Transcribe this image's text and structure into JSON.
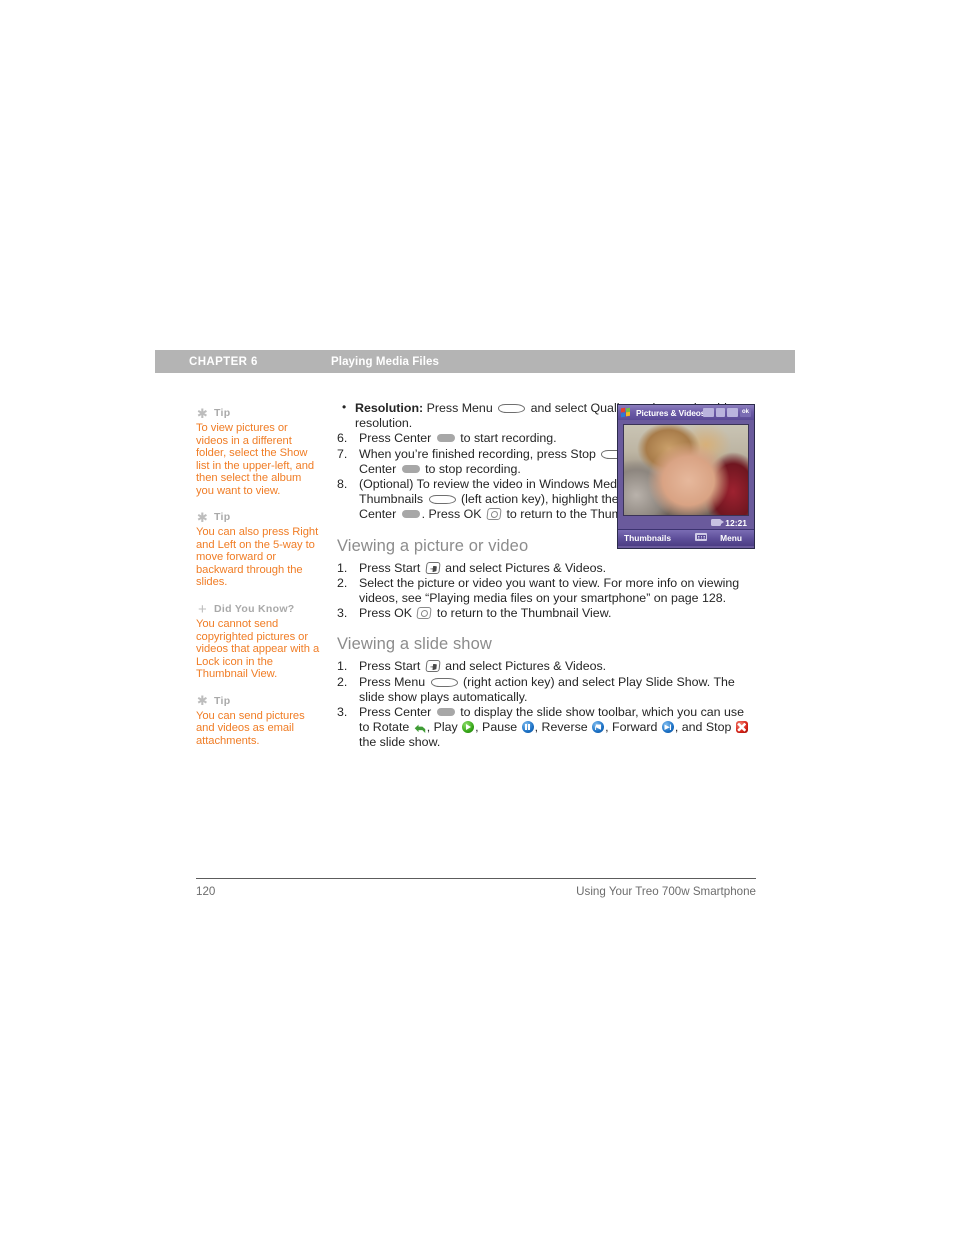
{
  "header": {
    "chapter_label": "CHAPTER 6",
    "chapter_title": "Playing Media Files"
  },
  "sidebar": {
    "tips": [
      {
        "icon": "asterisk-icon",
        "heading": "Tip",
        "body": "To view pictures or videos in a different folder, select the Show list in the upper-left, and then select the album you want to view."
      },
      {
        "icon": "asterisk-icon",
        "heading": "Tip",
        "body": "You can also press Right and Left on the 5-way to move forward or backward through the slides."
      },
      {
        "icon": "plus-icon",
        "heading": "Did You Know?",
        "body": "You cannot send copyrighted pictures or videos that appear with a Lock icon in the Thumbnail View."
      },
      {
        "icon": "asterisk-icon",
        "heading": "Tip",
        "body": "You can send pictures and videos as email attachments."
      }
    ],
    "accent_color": "#f07d26",
    "heading_color": "#a9a9a9"
  },
  "main": {
    "bullet": {
      "term": "Resolution:",
      "text_before_key": " Press Menu ",
      "text_after_key": " and select Quality to change the video resolution."
    },
    "steps_continued": [
      {
        "num": "6.",
        "parts": [
          "Press Center ",
          " to start recording."
        ]
      },
      {
        "num": "7.",
        "parts": [
          "When you’re finished recording, press Stop ",
          " (left action key) or Center ",
          " to stop recording."
        ]
      },
      {
        "num": "8.",
        "parts": [
          "(Optional) To review the video in Windows Media Player Mobile, press Thumbnails ",
          " (left action key), highlight the video, and then press Center ",
          ". Press OK ",
          " to return to the Thumbnail View."
        ]
      }
    ],
    "section_view_picture": {
      "heading": "Viewing a picture or video",
      "steps": [
        {
          "num": "1.",
          "parts": [
            "Press Start ",
            " and select Pictures & Videos."
          ]
        },
        {
          "num": "2.",
          "parts": [
            "Select the picture or video you want to view. For more info on viewing videos, see “Playing media files on your smartphone” on page 128."
          ]
        },
        {
          "num": "3.",
          "parts": [
            "Press OK ",
            " to return to the Thumbnail View."
          ]
        }
      ]
    },
    "section_slide_show": {
      "heading": "Viewing a slide show",
      "steps": [
        {
          "num": "1.",
          "parts": [
            "Press Start ",
            " and select Pictures & Videos."
          ]
        },
        {
          "num": "2.",
          "parts": [
            "Press Menu ",
            " (right action key) and select Play Slide Show. The slide show plays automatically."
          ]
        },
        {
          "num": "3.",
          "parts": [
            "Press Center ",
            " to display the slide show toolbar, which you can use to Rotate ",
            ", Play ",
            ", Pause ",
            ", Reverse ",
            ", Forward ",
            ", and Stop ",
            " the slide show."
          ]
        }
      ],
      "toolbar_icon_labels": [
        "Rotate",
        "Play",
        "Pause",
        "Reverse",
        "Forward",
        "Stop"
      ]
    }
  },
  "phone_screenshot": {
    "title": "Pictures & Videos",
    "status_icons": [
      "volume-icon",
      "signal-icon",
      "battery-icon",
      "ok-icon"
    ],
    "ok_label": "ok",
    "time": "12:21",
    "media_icon": "video-camera-icon",
    "softkey_left": "Thumbnails",
    "softkey_center_icon": "keyboard-icon",
    "softkey_right": "Menu",
    "title_bar_color": "#6d5ca8",
    "soft_bar_color": "#5d4e99"
  },
  "footer": {
    "page_number": "120",
    "book_title": "Using Your Treo 700w Smartphone"
  }
}
